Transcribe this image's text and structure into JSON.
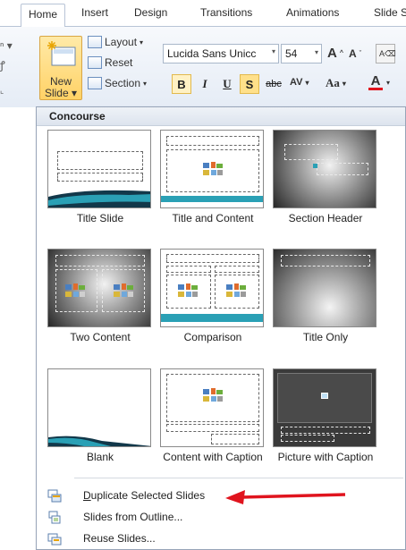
{
  "ribbon": {
    "tabs": [
      "Home",
      "Insert",
      "Design",
      "Transitions",
      "Animations",
      "Slide S"
    ],
    "new_slide_label": "New Slide",
    "layout_label": "Layout",
    "reset_label": "Reset",
    "section_label": "Section",
    "font_name": "Lucida Sans Unicc",
    "font_size": "54",
    "grow_font": "A",
    "shrink_font": "A",
    "bold": "B",
    "italic": "I",
    "underline": "U",
    "shadow": "S",
    "strike": "abc",
    "spacing": "AV",
    "change_case": "Aa",
    "font_color": "A"
  },
  "gallery": {
    "theme_name": "Concourse",
    "layouts": [
      {
        "label": "Title Slide"
      },
      {
        "label": "Title and Content"
      },
      {
        "label": "Section Header"
      },
      {
        "label": "Two Content"
      },
      {
        "label": "Comparison"
      },
      {
        "label": "Title Only"
      },
      {
        "label": "Blank"
      },
      {
        "label": "Content with Caption"
      },
      {
        "label": "Picture with Caption"
      }
    ]
  },
  "menu": [
    {
      "label": "Duplicate Selected Slides",
      "icon": "duplicate-slides-icon"
    },
    {
      "label": "Slides from Outline...",
      "icon": "outline-slides-icon"
    },
    {
      "label": "Reuse Slides...",
      "icon": "reuse-slides-icon"
    }
  ],
  "colors": {
    "accent_teal": "#2aa0b5",
    "highlight": "#ffd266",
    "annotation_arrow": "#e0141e"
  }
}
